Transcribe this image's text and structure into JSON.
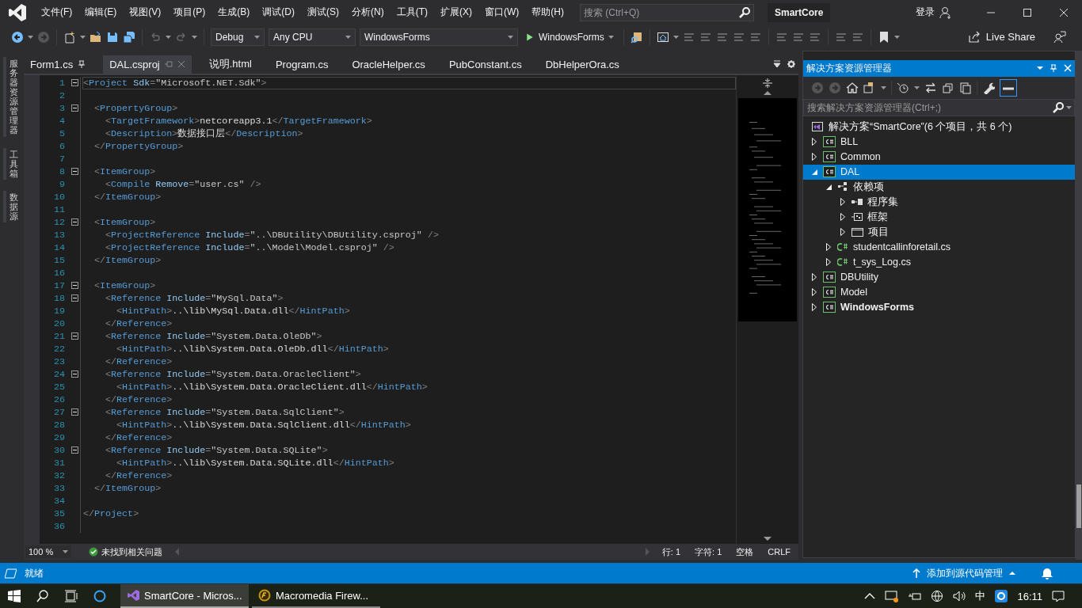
{
  "window": {
    "title": "SmartCore",
    "search": {
      "placeholder": "搜索 (Ctrl+Q)"
    },
    "sign_in": "登录"
  },
  "menu": [
    "文件(F)",
    "编辑(E)",
    "视图(V)",
    "项目(P)",
    "生成(B)",
    "调试(D)",
    "测试(S)",
    "分析(N)",
    "工具(T)",
    "扩展(X)",
    "窗口(W)",
    "帮助(H)"
  ],
  "toolbar": {
    "configuration": "Debug",
    "platform": "Any CPU",
    "startup_project": "WindowsForms",
    "start_button": "WindowsForms",
    "live_share": "Live Share"
  },
  "side_tabs": [
    "服务器资源管理器",
    "工具箱",
    "数据源"
  ],
  "document_tabs": [
    {
      "label": "Form1.cs",
      "selected": false,
      "pinned": true
    },
    {
      "label": "DAL.csproj",
      "selected": true,
      "pinned": false
    },
    {
      "label": "说明.html",
      "selected": false,
      "pinned": false
    },
    {
      "label": "Program.cs",
      "selected": false,
      "pinned": false
    },
    {
      "label": "OracleHelper.cs",
      "selected": false,
      "pinned": false
    },
    {
      "label": "PubConstant.cs",
      "selected": false,
      "pinned": false
    },
    {
      "label": "DbHelperOra.cs",
      "selected": false,
      "pinned": false
    }
  ],
  "editor": {
    "lines": [
      {
        "number": "1",
        "text": "<Project Sdk=\"Microsoft.NET.Sdk\">",
        "foldable": true,
        "current": true
      },
      {
        "number": "2",
        "foldable": false,
        "current": false
      },
      {
        "number": "3",
        "text": "  <PropertyGroup>",
        "foldable": true,
        "current": false
      },
      {
        "number": "4",
        "text": "    <TargetFramework>netcoreapp3.1</TargetFramework>",
        "foldable": false,
        "current": false
      },
      {
        "number": "5",
        "text": "    <Description>数据接口层</Description>",
        "foldable": false,
        "current": false
      },
      {
        "number": "6",
        "text": "  </PropertyGroup>",
        "foldable": false,
        "current": false
      },
      {
        "number": "7",
        "foldable": false,
        "current": false
      },
      {
        "number": "8",
        "text": "  <ItemGroup>",
        "foldable": true,
        "current": false
      },
      {
        "number": "9",
        "text": "    <Compile Remove=\"user.cs\" />",
        "foldable": false,
        "current": false
      },
      {
        "number": "10",
        "text": "  </ItemGroup>",
        "foldable": false,
        "current": false
      },
      {
        "number": "11",
        "foldable": false,
        "current": false
      },
      {
        "number": "12",
        "text": "  <ItemGroup>",
        "foldable": true,
        "current": false
      },
      {
        "number": "13",
        "text": "    <ProjectReference Include=\"..\\DBUtility\\DBUtility.csproj\" />",
        "foldable": false,
        "current": false
      },
      {
        "number": "14",
        "text": "    <ProjectReference Include=\"..\\Model\\Model.csproj\" />",
        "foldable": false,
        "current": false
      },
      {
        "number": "15",
        "text": "  </ItemGroup>",
        "foldable": false,
        "current": false
      },
      {
        "number": "16",
        "foldable": false,
        "current": false
      },
      {
        "number": "17",
        "text": "  <ItemGroup>",
        "foldable": true,
        "current": false
      },
      {
        "number": "18",
        "text": "    <Reference Include=\"MySql.Data\">",
        "foldable": true,
        "current": false
      },
      {
        "number": "19",
        "text": "      <HintPath>..\\lib\\MySql.Data.dll</HintPath>",
        "foldable": false,
        "current": false
      },
      {
        "number": "20",
        "text": "    </Reference>",
        "foldable": false,
        "current": false
      },
      {
        "number": "21",
        "text": "    <Reference Include=\"System.Data.OleDb\">",
        "foldable": true,
        "current": false
      },
      {
        "number": "22",
        "text": "      <HintPath>..\\lib\\System.Data.OleDb.dll</HintPath>",
        "foldable": false,
        "current": false
      },
      {
        "number": "23",
        "text": "    </Reference>",
        "foldable": false,
        "current": false
      },
      {
        "number": "24",
        "text": "    <Reference Include=\"System.Data.OracleClient\">",
        "foldable": true,
        "current": false
      },
      {
        "number": "25",
        "text": "      <HintPath>..\\lib\\System.Data.OracleClient.dll</HintPath>",
        "foldable": false,
        "current": false
      },
      {
        "number": "26",
        "text": "    </Reference>",
        "foldable": false,
        "current": false
      },
      {
        "number": "27",
        "text": "    <Reference Include=\"System.Data.SqlClient\">",
        "foldable": true,
        "current": false
      },
      {
        "number": "28",
        "text": "      <HintPath>..\\lib\\System.Data.SqlClient.dll</HintPath>",
        "foldable": false,
        "current": false
      },
      {
        "number": "29",
        "text": "    </Reference>",
        "foldable": false,
        "current": false
      },
      {
        "number": "30",
        "text": "    <Reference Include=\"System.Data.SQLite\">",
        "foldable": true,
        "current": false
      },
      {
        "number": "31",
        "text": "      <HintPath>..\\lib\\System.Data.SQLite.dll</HintPath>",
        "foldable": false,
        "current": false
      },
      {
        "number": "32",
        "text": "    </Reference>",
        "foldable": false,
        "current": false
      },
      {
        "number": "33",
        "text": "  </ItemGroup>",
        "foldable": false,
        "current": false
      },
      {
        "number": "34",
        "foldable": false,
        "current": false
      },
      {
        "number": "35",
        "text": "</Project>",
        "foldable": false,
        "current": false
      },
      {
        "number": "36",
        "foldable": false,
        "current": false
      }
    ],
    "zoom": "100 %",
    "issues": "未找到相关问题",
    "line": "行: 1",
    "char": "字符: 1",
    "spacing": "空格",
    "line_ending": "CRLF"
  },
  "solution_explorer": {
    "title": "解决方案资源管理器",
    "search": {
      "placeholder": "搜索解决方案资源管理器(Ctrl+;)"
    },
    "solution": "解决方案“SmartCore”(6 个项目，共 6 个)",
    "tree": [
      {
        "label": "BLL",
        "kind": "project",
        "expanded": false,
        "selected": false,
        "startup": false
      },
      {
        "label": "Common",
        "kind": "project",
        "expanded": false,
        "selected": false,
        "startup": false
      },
      {
        "label": "DAL",
        "kind": "project",
        "expanded": true,
        "selected": true,
        "startup": false,
        "children": [
          {
            "label": "依赖项",
            "kind": "dependencies",
            "expanded": true,
            "selected": false,
            "children": [
              {
                "label": "程序集",
                "kind": "assemblies",
                "expanded": false,
                "selected": false
              },
              {
                "label": "框架",
                "kind": "frameworks",
                "expanded": false,
                "selected": false
              },
              {
                "label": "项目",
                "kind": "projects",
                "expanded": false,
                "selected": false
              }
            ]
          },
          {
            "label": "studentcallinforetail.cs",
            "kind": "csfile",
            "expanded": false,
            "selected": false
          },
          {
            "label": "t_sys_Log.cs",
            "kind": "csfile",
            "expanded": false,
            "selected": false
          }
        ]
      },
      {
        "label": "DBUtility",
        "kind": "project",
        "expanded": false,
        "selected": false,
        "startup": false
      },
      {
        "label": "Model",
        "kind": "project",
        "expanded": false,
        "selected": false,
        "startup": false
      },
      {
        "label": "WindowsForms",
        "kind": "project",
        "expanded": false,
        "selected": false,
        "startup": true
      }
    ]
  },
  "status_bar": {
    "text": "就绪",
    "source_control": "添加到源代码管理"
  },
  "taskbar": {
    "apps": [
      {
        "label": "SmartCore - Micros...",
        "kind": "vs",
        "selected": true
      },
      {
        "label": "Macromedia Firew...",
        "kind": "fireworks",
        "selected": false
      }
    ],
    "ime": "中",
    "time": "16:11"
  }
}
